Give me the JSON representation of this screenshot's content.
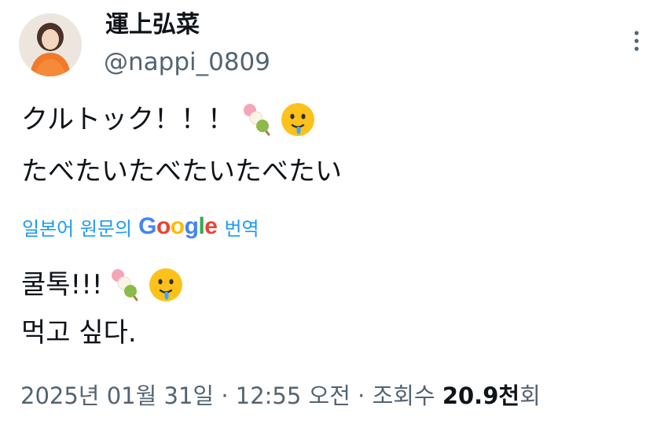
{
  "author": {
    "display_name": "運上弘菜",
    "handle": "@nappi_0809"
  },
  "tweet": {
    "original_lines": [
      "クルトック！！！",
      "たべたいたべたいたべたい"
    ],
    "translate_prefix": "일본어 원문의",
    "translate_brand": "Google",
    "translate_suffix": "번역",
    "translated_lines": [
      "쿨톡!!!",
      "먹고 싶다."
    ]
  },
  "meta": {
    "date": "2025년 01월 31일",
    "separator": "·",
    "time": "12:55 오전",
    "views_label": "조회수",
    "views_count": "20.9",
    "views_unit": "천",
    "views_suffix": "회"
  },
  "icons": {
    "more": "more-vertical-icon",
    "dango": "dango-emoji",
    "face": "face-holding-back-tears-emoji"
  },
  "colors": {
    "link": "#1d9bf0",
    "secondary_text": "#536471",
    "primary_text": "#0f1419"
  }
}
